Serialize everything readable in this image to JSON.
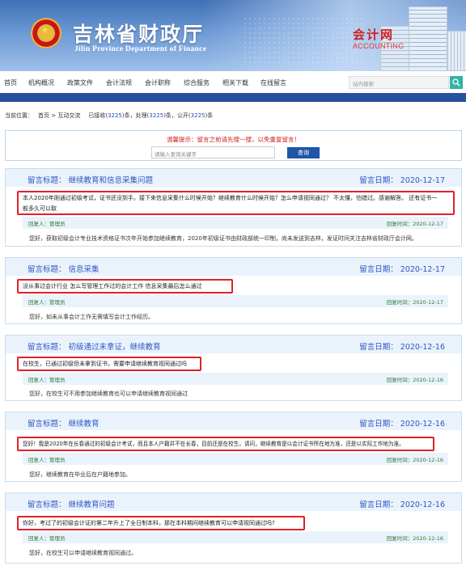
{
  "header": {
    "site_title": "吉林省财政厅",
    "site_subtitle": "Jilin Province Department of Finance",
    "section_title": "会计网",
    "section_subtitle": "ACCOUNTING"
  },
  "nav": {
    "items": [
      "首页",
      "机构概况",
      "政策文件",
      "会计法规",
      "会计职称",
      "综合服务",
      "相关下载",
      "在线留言"
    ],
    "search_placeholder": "站内搜索"
  },
  "breadcrumb": {
    "label": "当前位置：",
    "path": "首页 > 互动交流",
    "received_prefix": "已接收(",
    "received": "3225",
    "received_suffix": ")条，处理(",
    "processed": "3225",
    "processed_suffix": ")条，公开(",
    "published": "3225",
    "published_suffix": ")条"
  },
  "notice": {
    "tip": "温馨提示：留言之前请先搜一搜，以免重复留言！",
    "input_placeholder": "请输入查询关键字",
    "query_button": "查询"
  },
  "messages": [
    {
      "title": "留言标题： 继续教育和信息采集问题",
      "date": "留言日期： 2020-12-17",
      "body_line1": "本人2020年刚通过初级考试，证书还没到手。接下来信息采集什么时候开始？继续教育什么时候开始？怎么申请视同通过？ 不太懂，怕错过。感谢解答。 还有证书一",
      "body_line2": "般多久可以取",
      "replier": "回复人：管理员",
      "reply_date": "回复时间：2020-12-17",
      "reply": "您好，获取初级会计专业技术资格证书次年开始参加继续教育，2020年初级证书由财政部统一印制，尚未发送到吉林，发证时间关注吉林省财政厅会计网。"
    },
    {
      "title": "留言标题： 信息采集",
      "date": "留言日期： 2020-12-17",
      "body_line1": "没从事过会计行业 怎么写管理工作过的会计工作 信息采集最后怎么通过",
      "replier": "回复人：管理员",
      "reply_date": "回复时间：2020-12-17",
      "reply": "您好，如未从事会计工作无需填写会计工作经历。"
    },
    {
      "title": "留言标题： 初级通过未拿证，继续教育",
      "date": "留言日期： 2020-12-16",
      "body_line1": "在校生，已通过初级但未拿到证书，需要申请继续教育视同通过吗",
      "replier": "回复人：管理员",
      "reply_date": "回复时间：2020-12-16",
      "reply": "您好，在校生可不用参加继续教育也可以申请继续教育视同通过"
    },
    {
      "title": "留言标题： 继续教育",
      "date": "留言日期： 2020-12-16",
      "body_line1": "您好！我是2020年在长春通过的初级会计考试，而且本人户籍并不在长春，目前还是在校生。请问，继续教育是以会计证书所在地为准，还是以实际工作地为准。",
      "replier": "回复人：管理员",
      "reply_date": "回复时间：2020-12-16",
      "reply": "您好，继续教育在毕业后在户籍地参加。"
    },
    {
      "title": "留言标题： 继续教育问题",
      "date": "留言日期： 2020-12-16",
      "body_line1": "你好，考过了的初级会计证的第二年升上了全日制本科，那在本科期间继续教育可以申请视同通过吗?",
      "replier": "回复人：管理员",
      "reply_date": "回复时间：2020-12-16",
      "reply": "您好，在校生可以申请继续教育视同通过。"
    }
  ],
  "colors": {
    "header_blue": "#3f6fb6",
    "strip_blue": "#2a4f9f",
    "title_blue": "#2f55c4",
    "highlight_red": "#e0212a",
    "reply_green": "#2f7a2f",
    "search_teal": "#34b2a8"
  }
}
